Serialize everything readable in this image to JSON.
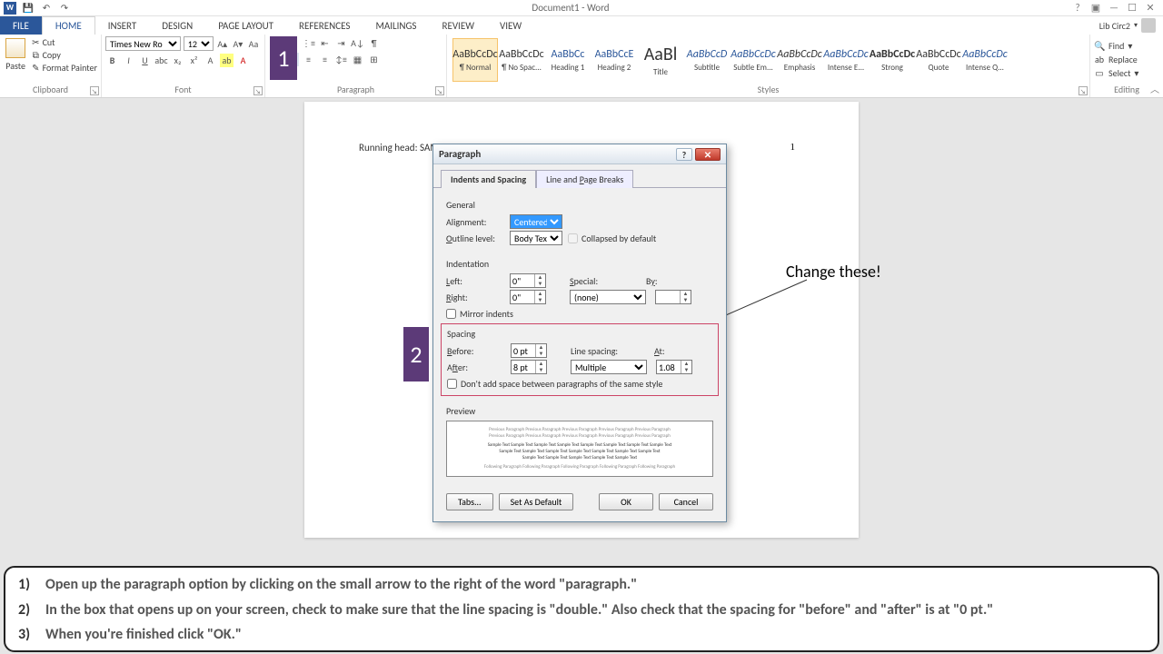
{
  "titlebar": {
    "doc_title": "Document1 - Word",
    "user": "Lib Circ2"
  },
  "tabs": {
    "file": "FILE",
    "home": "HOME",
    "insert": "INSERT",
    "design": "DESIGN",
    "page_layout": "PAGE LAYOUT",
    "references": "REFERENCES",
    "mailings": "MAILINGS",
    "review": "REVIEW",
    "view": "VIEW"
  },
  "clipboard": {
    "paste": "Paste",
    "cut": "Cut",
    "copy": "Copy",
    "format_painter": "Format Painter",
    "label": "Clipboard"
  },
  "font": {
    "name": "Times New Ro",
    "size": "12",
    "label": "Font"
  },
  "paragraph": {
    "label": "Paragraph"
  },
  "styles": {
    "label": "Styles",
    "items": [
      {
        "preview": "AaBbCcDc",
        "name": "¶ Normal"
      },
      {
        "preview": "AaBbCcDc",
        "name": "¶ No Spac..."
      },
      {
        "preview": "AaBbCc",
        "name": "Heading 1"
      },
      {
        "preview": "AaBbCcE",
        "name": "Heading 2"
      },
      {
        "preview": "AaBl",
        "name": "Title"
      },
      {
        "preview": "AaBbCcD",
        "name": "Subtitle"
      },
      {
        "preview": "AaBbCcDc",
        "name": "Subtle Em..."
      },
      {
        "preview": "AaBbCcDc",
        "name": "Emphasis"
      },
      {
        "preview": "AaBbCcDc",
        "name": "Intense E..."
      },
      {
        "preview": "AaBbCcDc",
        "name": "Strong"
      },
      {
        "preview": "AaBbCcDc",
        "name": "Quote"
      },
      {
        "preview": "AaBbCcDc",
        "name": "Intense Q..."
      }
    ]
  },
  "editing": {
    "find": "Find",
    "replace": "Replace",
    "select": "Select",
    "label": "Editing"
  },
  "page": {
    "running_head": "Running head: SAMPLE APA PAPER",
    "page_num": "1"
  },
  "markers": {
    "m1": "1",
    "m2": "2"
  },
  "dialog": {
    "title": "Paragraph",
    "tab1": "Indents and Spacing",
    "tab2_pre": "Line and ",
    "tab2_u": "P",
    "tab2_post": "age Breaks",
    "general": "General",
    "alignment_label_u": "G",
    "alignment_label": "Alignment:",
    "alignment_val": "Centered",
    "outline_label_u": "O",
    "outline_label": "utline level:",
    "outline_val": "Body Text",
    "collapsed_u": "E",
    "collapsed": "Collapsed by default",
    "indentation": "Indentation",
    "left_u": "L",
    "left": "eft:",
    "left_val": "0\"",
    "right_u": "R",
    "right": "ight:",
    "right_val": "0\"",
    "special_u": "S",
    "special": "pecial:",
    "special_val": "(none)",
    "by_u": "y",
    "by": "B",
    "by_val": "",
    "mirror_u": "M",
    "mirror": "irror indents",
    "spacing": "Spacing",
    "before_u": "B",
    "before": "efore:",
    "before_val": "0 pt",
    "after_u": "f",
    "after_pre": "A",
    "after_post": "ter:",
    "after_val": "8 pt",
    "linespacing_u": "N",
    "linespacing": "Line spacing:",
    "linespacing_val": "Multiple",
    "at_u": "A",
    "at": "t:",
    "at_val": "1.08",
    "dontadd_u": "c",
    "dontadd": "Don't add space between paragraphs of the same style",
    "preview": "Preview",
    "tabs_btn": "Tabs...",
    "setdefault_btn": "Set As Default",
    "ok_btn": "OK",
    "cancel_btn": "Cancel"
  },
  "annotation": "Change these!",
  "instructions": {
    "n1": "1)",
    "t1": "Open up the paragraph option by clicking on the small arrow to the right of the word \"paragraph.\"",
    "n2": "2)",
    "t2": "In the box that opens up on your screen, check to make sure that the line spacing is \"double.\"  Also check that the spacing for \"before\" and \"after\" is at \"0 pt.\"",
    "n3": "3)",
    "t3": "When you're finished click \"OK.\""
  },
  "preview_text": {
    "l1": "Previous Paragraph Previous Paragraph Previous Paragraph Previous Paragraph Previous Paragraph",
    "l2": "Previous Paragraph Previous Paragraph Previous Paragraph Previous Paragraph Previous Paragraph",
    "l3": "Sample Text Sample Text Sample Text Sample Text Sample Text Sample Text Sample Text Sample Text",
    "l4": "Sample Text Sample Text Sample Text Sample Text Sample Text Sample Text Sample Text",
    "l5": "Sample Text Sample Text Sample Text Sample Text Sample Text",
    "l6": "Following Paragraph Following Paragraph Following Paragraph Following Paragraph Following Paragraph"
  }
}
